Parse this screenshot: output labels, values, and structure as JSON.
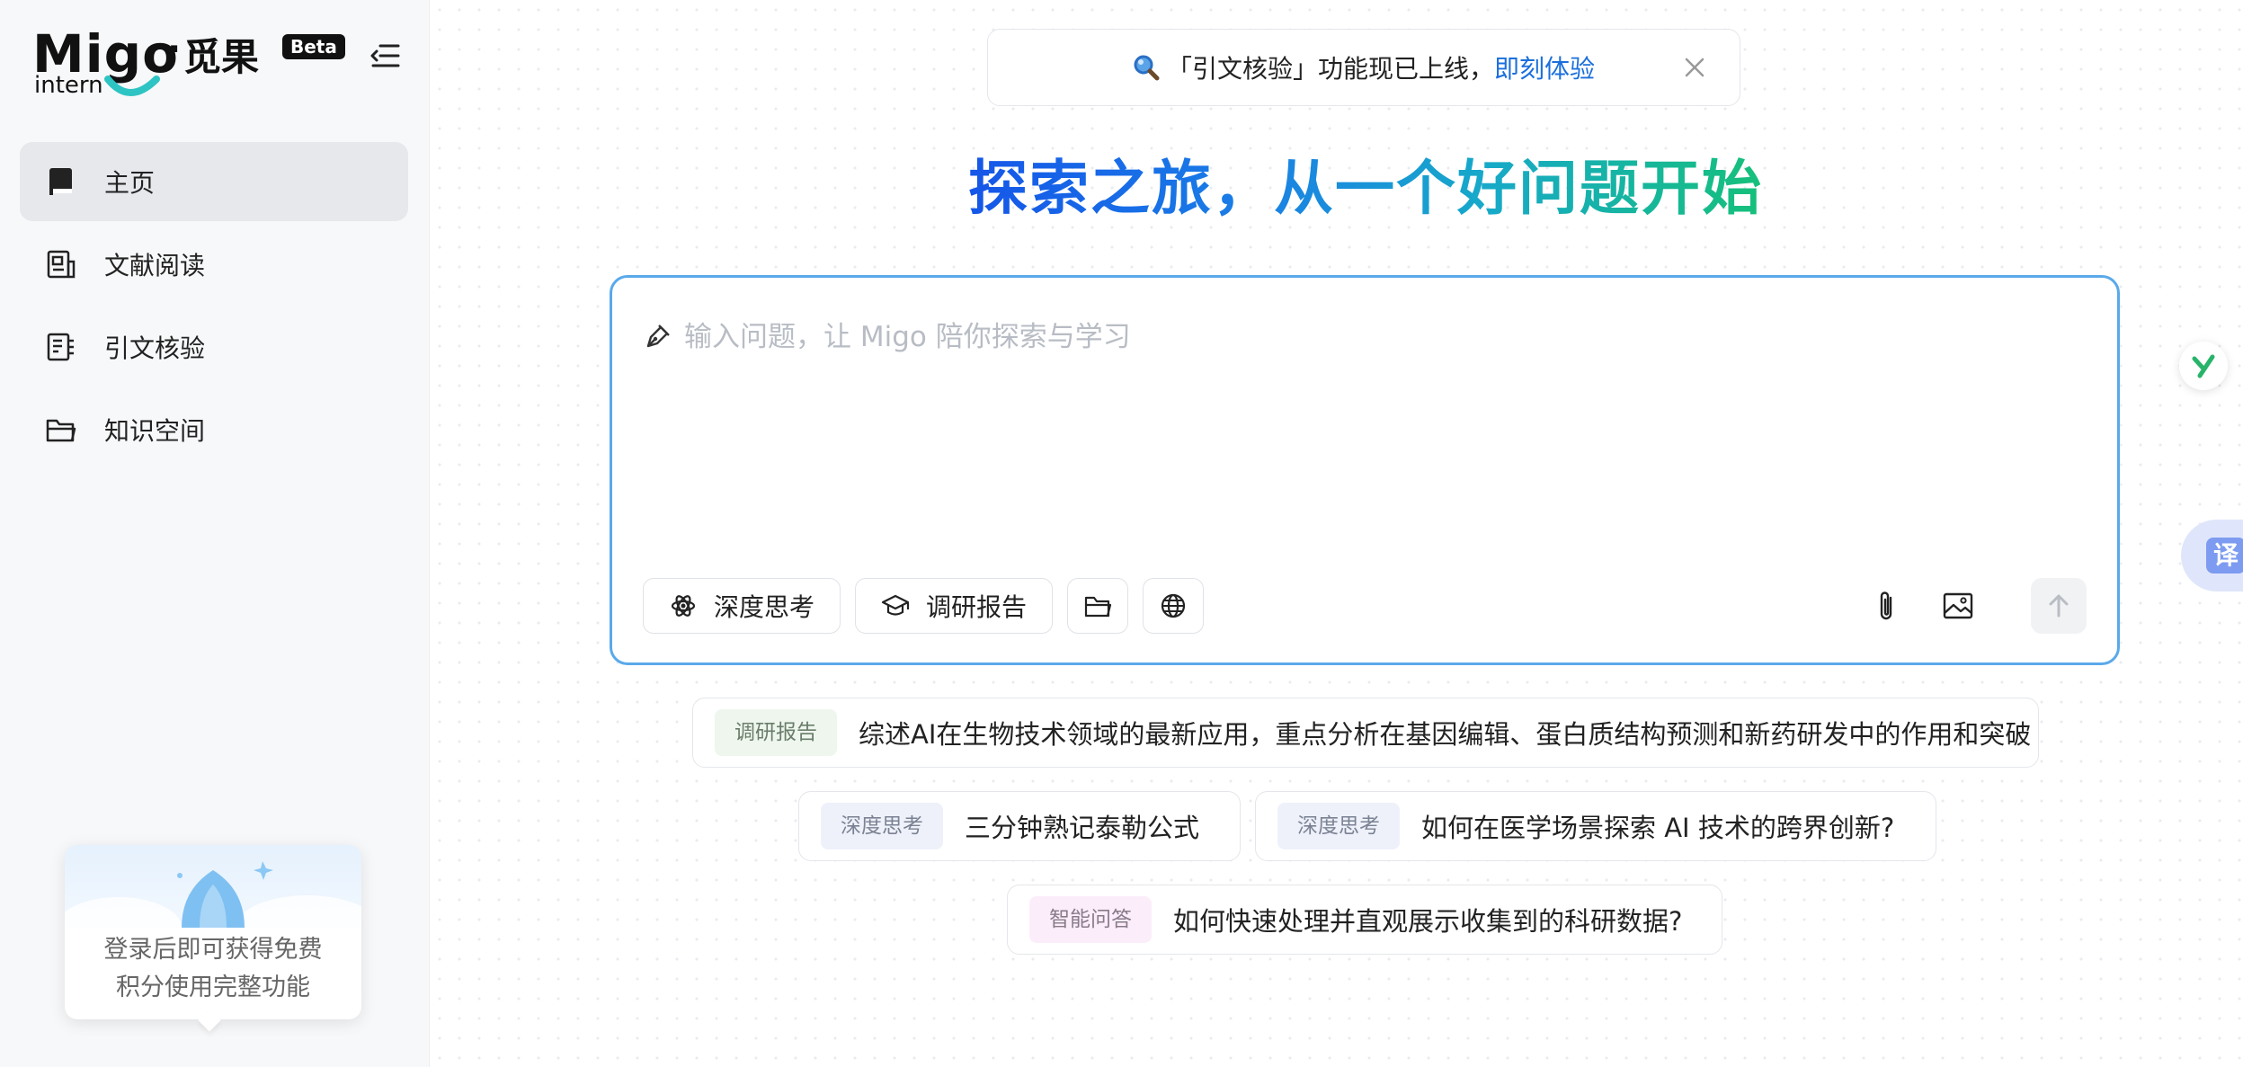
{
  "brand": {
    "name_en": "Migo",
    "dot": "·",
    "name_cn": "觅果",
    "badge": "Beta",
    "sub": "intern"
  },
  "sidebar": {
    "items": [
      {
        "label": "主页",
        "icon": "book-icon",
        "active": true
      },
      {
        "label": "文献阅读",
        "icon": "document-read-icon",
        "active": false
      },
      {
        "label": "引文核验",
        "icon": "citation-check-icon",
        "active": false
      },
      {
        "label": "知识空间",
        "icon": "folder-icon",
        "active": false
      }
    ],
    "login_line1": "登录后即可获得免费",
    "login_line2": "积分使用完整功能"
  },
  "notice": {
    "text": "「引文核验」功能现已上线，",
    "link": "即刻体验"
  },
  "hero": {
    "title": "探索之旅，从一个好问题开始"
  },
  "composer": {
    "placeholder": "输入问题，让 Migo 陪你探索与学习",
    "deep_think": "深度思考",
    "research_report": "调研报告"
  },
  "suggestions": [
    {
      "tag": "调研报告",
      "text": "综述AI在生物技术领域的最新应用，重点分析在基因编辑、蛋白质结构预测和新药研发中的作用和突破"
    },
    {
      "tag": "深度思考",
      "text": "三分钟熟记泰勒公式"
    },
    {
      "tag": "深度思考",
      "text": "如何在医学场景探索 AI 技术的跨界创新?"
    },
    {
      "tag": "智能问答",
      "text": "如何快速处理并直观展示收集到的科研数据?"
    }
  ],
  "floating": {
    "translate": "译"
  },
  "colors": {
    "accent_blue": "#1b6fdc",
    "composer_border": "#5aa9ea",
    "gradient_start": "#1556e8",
    "gradient_end": "#16c07a"
  }
}
